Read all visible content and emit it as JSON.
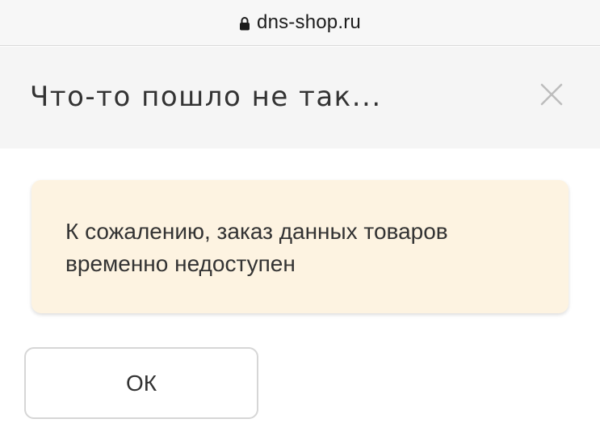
{
  "browser": {
    "domain": "dns-shop.ru",
    "lock_icon": "lock-icon"
  },
  "modal": {
    "title": "Что-то пошло не так...",
    "close_icon": "close-icon",
    "message": "К сожалению, заказ данных товаров временно недоступен",
    "ok_label": "ОК"
  },
  "colors": {
    "header_background": "#f5f5f5",
    "alert_background": "#fdf3e1",
    "text": "#333333",
    "close_icon": "#bdbdbd"
  }
}
